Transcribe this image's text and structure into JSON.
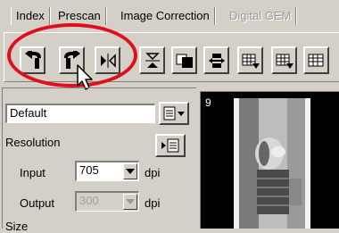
{
  "tabs": [
    {
      "label": "Index",
      "active": true
    },
    {
      "label": "Prescan",
      "active": false
    },
    {
      "label": "Image Correction",
      "active": false
    },
    {
      "label": "Digital GEM",
      "active": false,
      "disabled": true
    }
  ],
  "toolbar": {
    "buttons": [
      {
        "name": "rotate-left",
        "icon": "rotate-left-icon"
      },
      {
        "name": "rotate-right",
        "icon": "rotate-right-icon"
      },
      {
        "name": "flip-horizontal",
        "icon": "flip-horizontal-icon"
      },
      {
        "name": "flip-vertical",
        "icon": "flip-vertical-icon"
      },
      {
        "name": "invert",
        "icon": "invert-icon"
      },
      {
        "name": "swap",
        "icon": "swap-icon"
      },
      {
        "name": "settings-a",
        "icon": "grid-arrow-icon"
      },
      {
        "name": "settings-b",
        "icon": "grid-arrow-icon"
      },
      {
        "name": "settings-c",
        "icon": "grid-icon"
      }
    ]
  },
  "highlight_color": "#e0101a",
  "panel": {
    "preset_value": "Default",
    "resolution_label": "Resolution",
    "input_label": "Input",
    "input_value": "705",
    "input_unit": "dpi",
    "output_label": "Output",
    "output_value": "300",
    "output_unit": "dpi",
    "size_label": "Size"
  },
  "viewer": {
    "frame_number": "9"
  }
}
